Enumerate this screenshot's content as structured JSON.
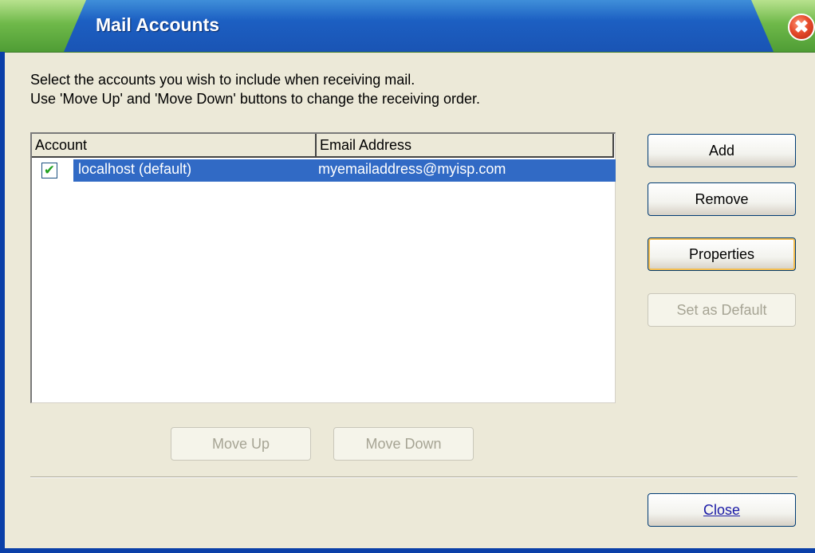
{
  "window": {
    "title": "Mail Accounts",
    "close_glyph": "✖"
  },
  "instructions": {
    "line1": "Select the accounts you wish to include when receiving mail.",
    "line2": "Use 'Move Up' and 'Move Down' buttons to change the receiving order."
  },
  "accounts_list": {
    "columns": [
      "Account",
      "Email Address"
    ],
    "rows": [
      {
        "checked": true,
        "account": "localhost (default)",
        "email": "myemailaddress@myisp.com",
        "selected": true
      }
    ]
  },
  "buttons": {
    "add": "Add",
    "remove": "Remove",
    "properties": "Properties",
    "set_default": "Set as Default",
    "move_up": "Move Up",
    "move_down": "Move Down",
    "close": "Close"
  },
  "colors": {
    "titlebar_blue": "#1c5fc2",
    "titlebar_green": "#6fb94a",
    "selection": "#316ac5",
    "dialog_bg": "#ece9d8"
  },
  "icons": {
    "close": "close-icon",
    "checkbox": "checkmark-icon"
  }
}
